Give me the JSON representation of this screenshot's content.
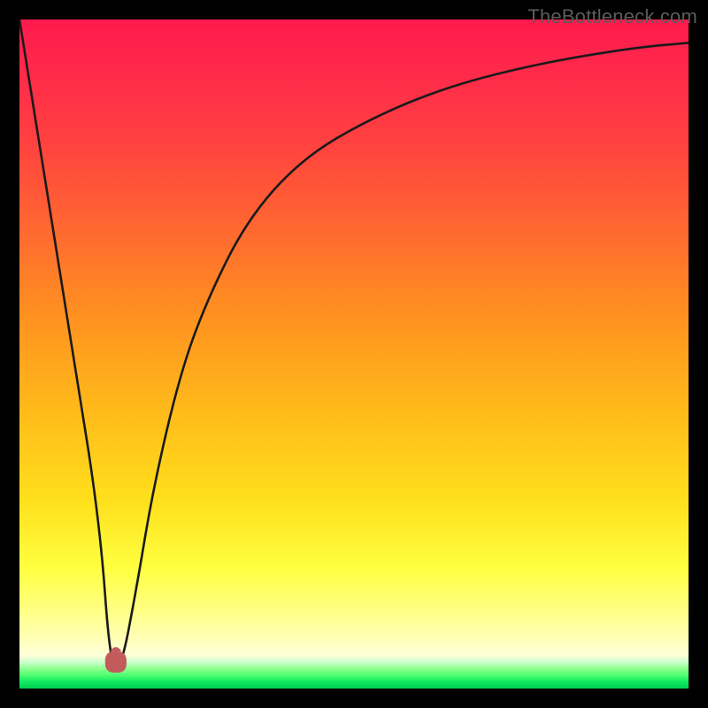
{
  "attribution": "TheBottleneck.com",
  "colors": {
    "frame": "#000000",
    "attribution_text": "#5c5c5c",
    "curve": "#1a1a1a",
    "bump": "#c25b5b"
  },
  "chart_data": {
    "type": "line",
    "title": "",
    "xlabel": "",
    "ylabel": "",
    "xlim": [
      0,
      100
    ],
    "ylim": [
      0,
      100
    ],
    "grid": false,
    "legend_position": "none",
    "x": [
      0,
      4,
      8,
      12,
      13.6,
      15.2,
      17.5,
      20,
      24,
      28,
      34,
      42,
      52,
      64,
      78,
      92,
      100
    ],
    "values": [
      100,
      75,
      50,
      25,
      3,
      3,
      15,
      30,
      47,
      58,
      70,
      79,
      85,
      90,
      93.5,
      95.8,
      96.5
    ],
    "annotations": [
      {
        "name": "bump",
        "x_center": 14.4,
        "y_value": 3,
        "width": 3.2,
        "height": 3.2
      }
    ]
  }
}
